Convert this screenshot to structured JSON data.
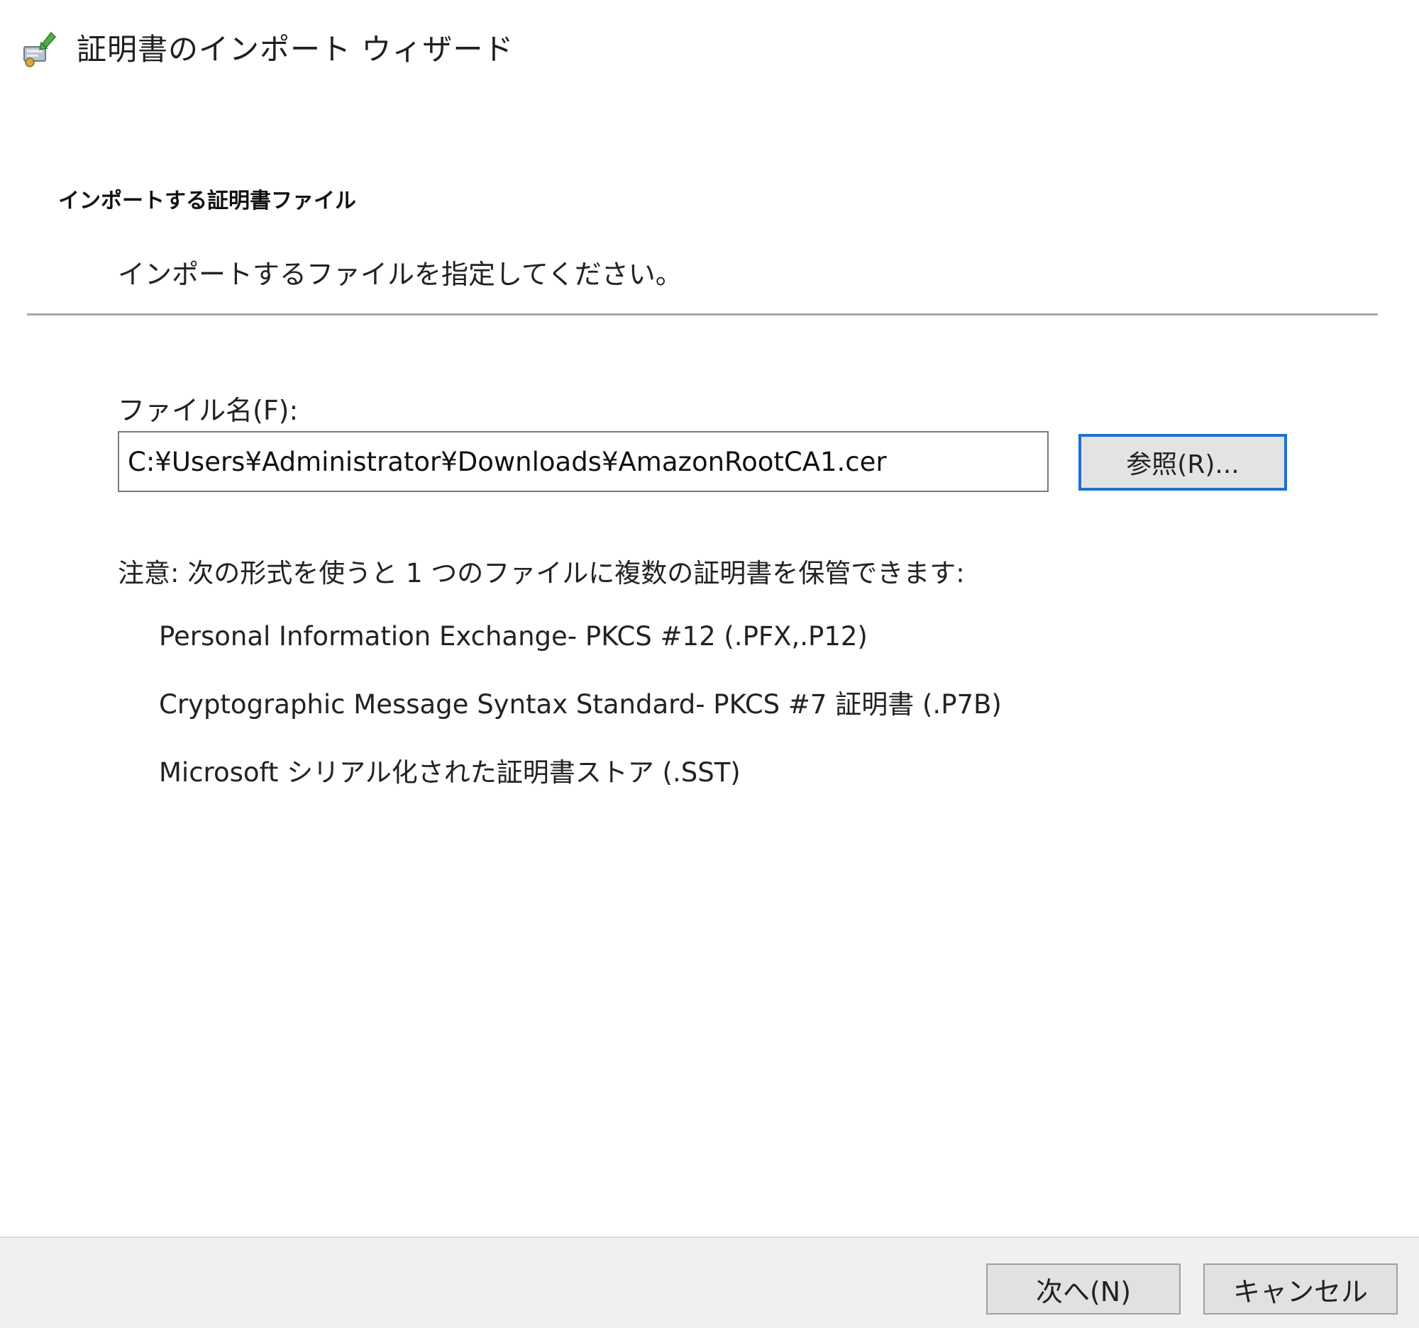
{
  "window": {
    "title": "証明書のインポート ウィザード",
    "icon": "certificate-import-icon"
  },
  "header": {
    "heading": "インポートする証明書ファイル",
    "subheading": "インポートするファイルを指定してください。"
  },
  "file": {
    "label": "ファイル名(F):",
    "value": "C:¥Users¥Administrator¥Downloads¥AmazonRootCA1.cer",
    "browse_label": "参照(R)..."
  },
  "note": "注意: 次の形式を使うと 1 つのファイルに複数の証明書を保管できます:",
  "formats": [
    "Personal Information Exchange- PKCS #12 (.PFX,.P12)",
    "Cryptographic Message Syntax Standard- PKCS #7 証明書 (.P7B)",
    "Microsoft シリアル化された証明書ストア (.SST)"
  ],
  "footer": {
    "next_label": "次へ(N)",
    "cancel_label": "キャンセル"
  },
  "colors": {
    "focus_border": "#1e6fd0",
    "footer_bg": "#f0f0f0",
    "button_bg": "#e1e1e1"
  }
}
